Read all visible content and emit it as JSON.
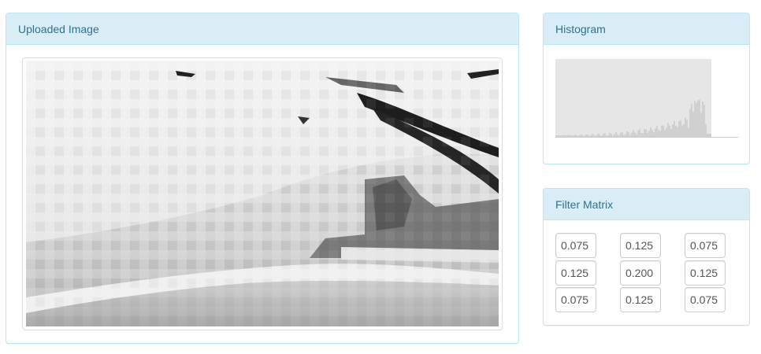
{
  "upload_panel": {
    "title": "Uploaded Image"
  },
  "histogram_panel": {
    "title": "Histogram"
  },
  "filter_panel": {
    "title": "Filter Matrix",
    "matrix": [
      [
        "0.075",
        "0.125",
        "0.075"
      ],
      [
        "0.125",
        "0.200",
        "0.125"
      ],
      [
        "0.075",
        "0.125",
        "0.075"
      ]
    ]
  },
  "colors": {
    "panel_border": "#bce8f1",
    "panel_heading_bg": "#d9edf7",
    "panel_heading_text": "#31708f",
    "histogram_fill": "#e6e6e6"
  }
}
